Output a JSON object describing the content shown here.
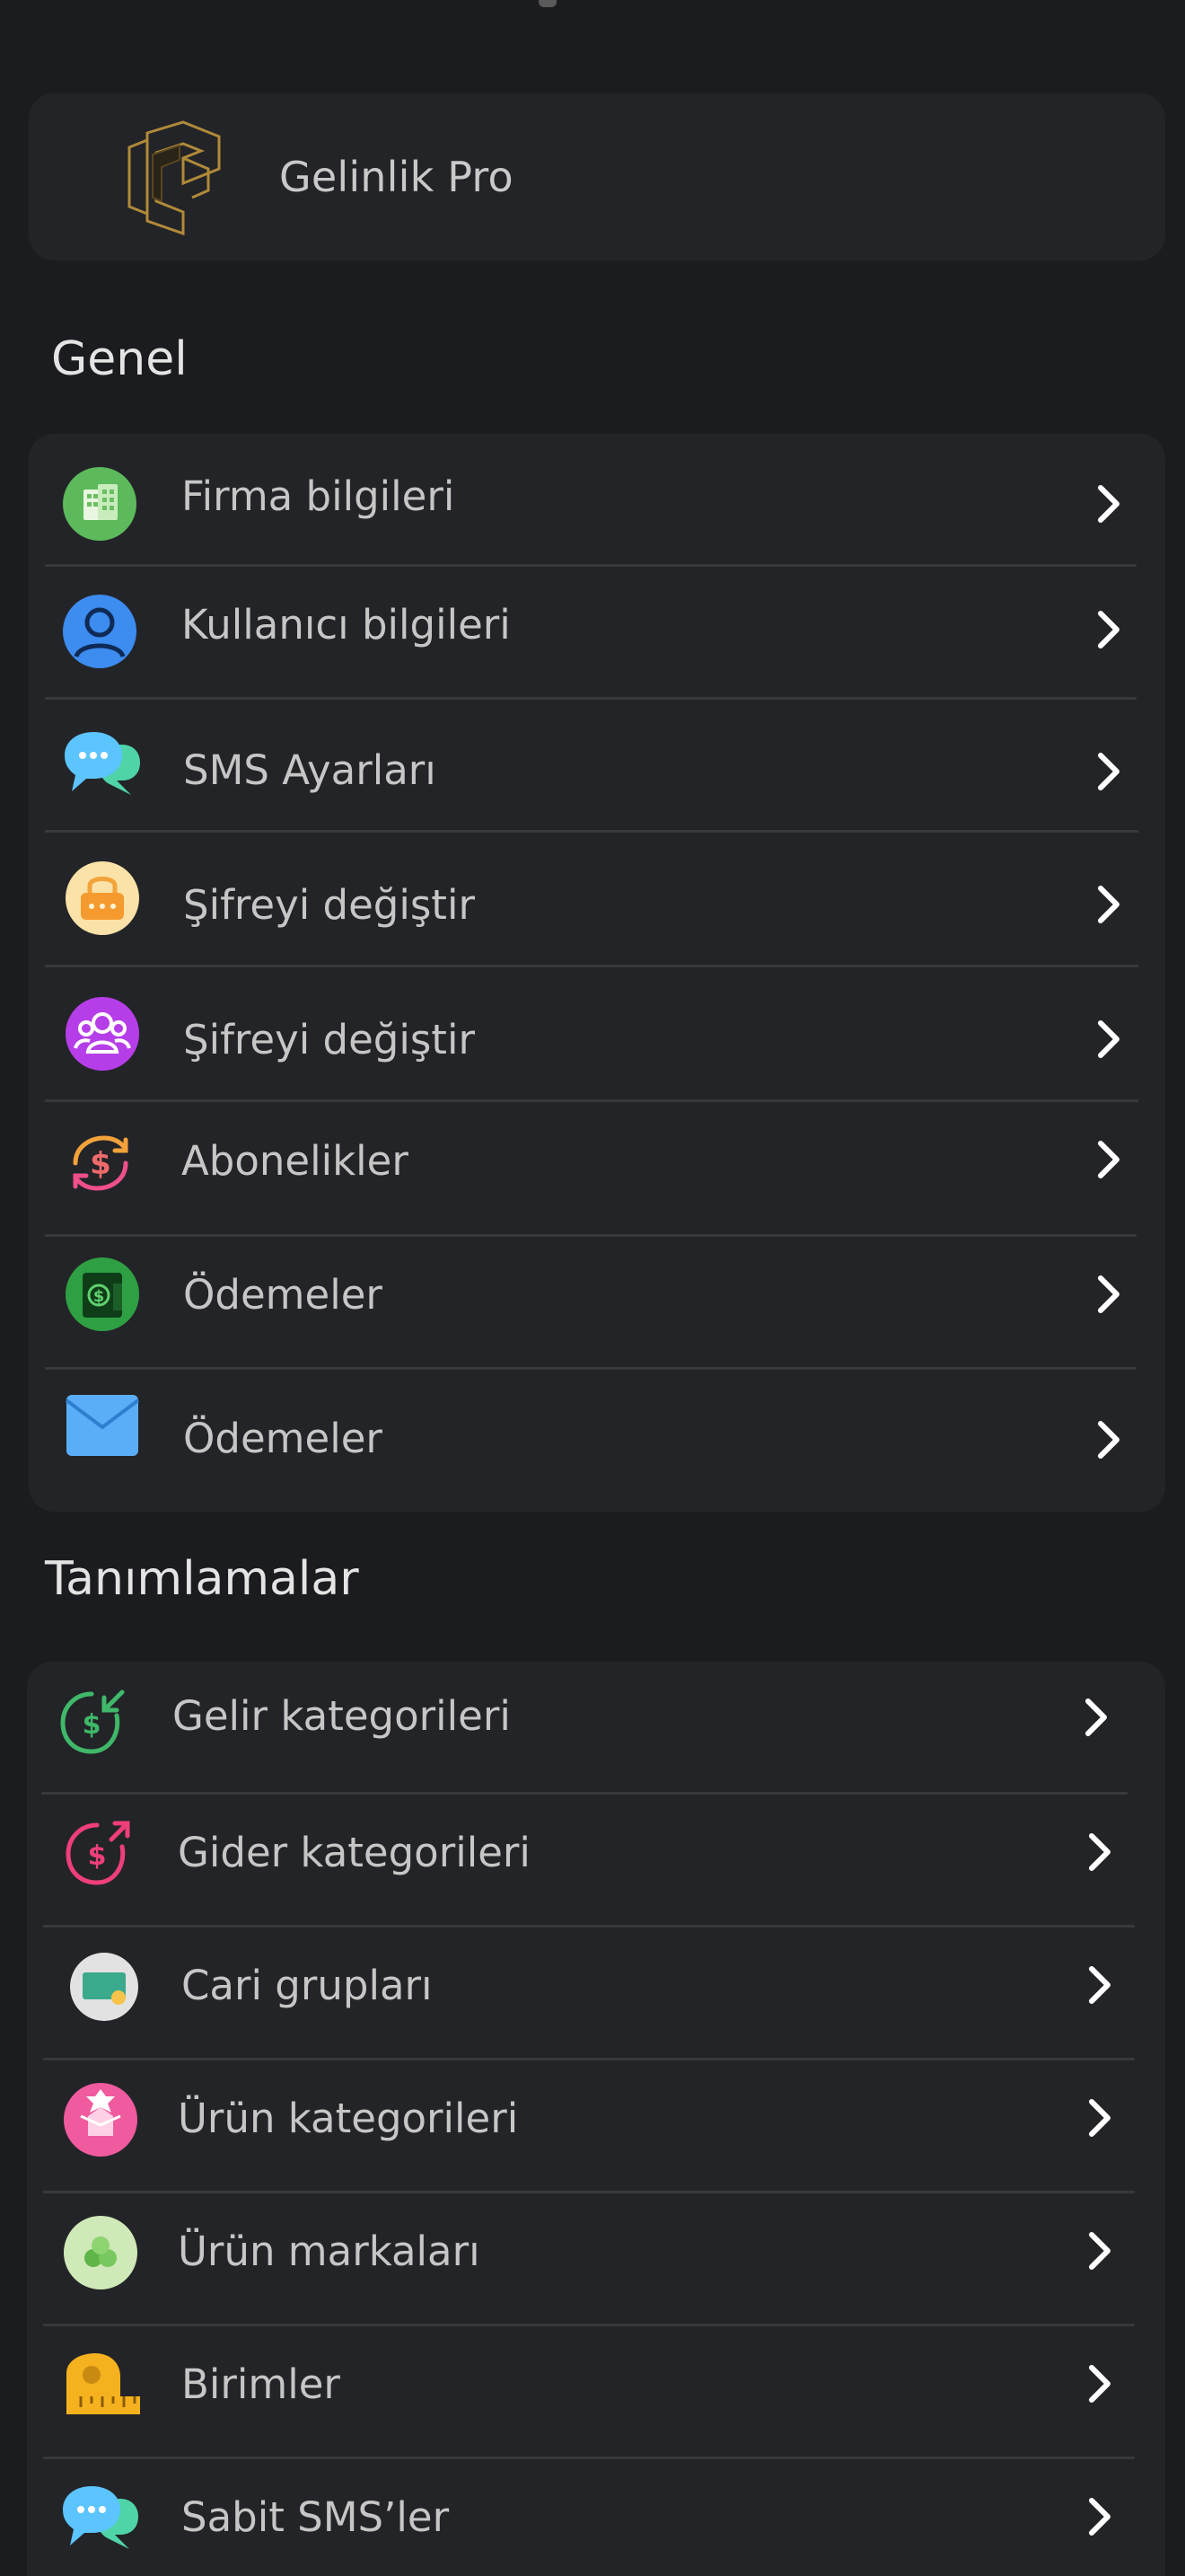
{
  "brand": {
    "name": "Gelinlik Pro"
  },
  "sections": [
    {
      "title": "Genel",
      "items": [
        {
          "label": "Firma bilgileri",
          "icon": "building-icon"
        },
        {
          "label": "Kullanıcı bilgileri",
          "icon": "user-icon"
        },
        {
          "label": "SMS Ayarları",
          "icon": "chat-bubble-icon"
        },
        {
          "label": "Şifreyi değiştir",
          "icon": "lock-icon"
        },
        {
          "label": "Şifreyi değiştir",
          "icon": "users-icon"
        },
        {
          "label": "Abonelikler",
          "icon": "subscription-icon"
        },
        {
          "label": "Ödemeler",
          "icon": "wallet-icon"
        },
        {
          "label": "Ödemeler",
          "icon": "mail-icon"
        }
      ]
    },
    {
      "title": "Tanımlamalar",
      "items": [
        {
          "label": "Gelir kategorileri",
          "icon": "income-icon"
        },
        {
          "label": "Gider kategorileri",
          "icon": "expense-icon"
        },
        {
          "label": "Cari grupları",
          "icon": "card-icon"
        },
        {
          "label": "Ürün kategorileri",
          "icon": "gift-box-icon"
        },
        {
          "label": "Ürün markaları",
          "icon": "brand-icon"
        },
        {
          "label": "Birimler",
          "icon": "measure-tape-icon"
        },
        {
          "label": "Sabit SMS’ler",
          "icon": "chat-bubble-icon"
        }
      ]
    }
  ],
  "colors": {
    "background": "#1b1c1f",
    "card": "#232427",
    "divider": "#38393c",
    "text": "#c6c6c6",
    "heading": "#e4e4e4"
  }
}
